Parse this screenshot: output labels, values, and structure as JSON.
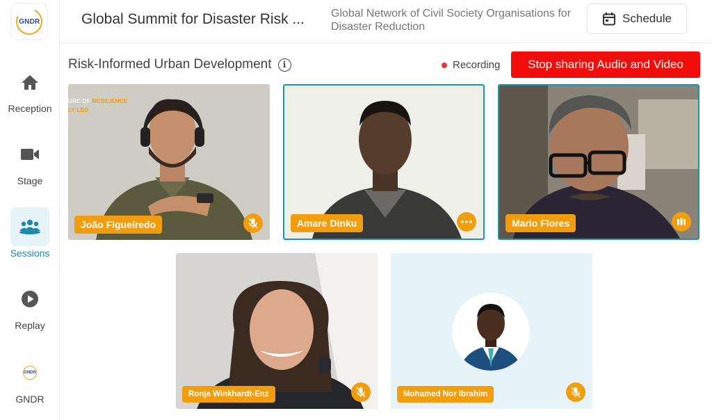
{
  "sidebar": {
    "logo_text": "GNDR",
    "items": [
      {
        "label": "Reception",
        "icon": "home-icon"
      },
      {
        "label": "Stage",
        "icon": "video-camera-icon"
      },
      {
        "label": "Sessions",
        "icon": "people-group-icon",
        "active": true
      },
      {
        "label": "Replay",
        "icon": "play-icon"
      },
      {
        "label": "GNDR",
        "icon": "gndr-logo-icon"
      }
    ]
  },
  "header": {
    "event_title": "Global Summit for Disaster Risk ...",
    "organization": "Global Network of Civil Society Organisations for Disaster Reduction",
    "schedule_label": "Schedule"
  },
  "session": {
    "title": "Risk-Informed Urban Development",
    "info_icon": "i",
    "recording_label": "Recording",
    "stop_label": "Stop sharing Audio and Video"
  },
  "participants": [
    {
      "name": "João Figueiredo",
      "status": "muted",
      "backdrop_text_1": "URE OF RESILIENCE",
      "backdrop_text_2": "LY LED"
    },
    {
      "name": "Amare Dinku",
      "status": "more",
      "speaking": true
    },
    {
      "name": "Mario Flores",
      "status": "talking",
      "speaking": true
    },
    {
      "name": "Ronja Winkhardt-Enz",
      "status": "muted"
    },
    {
      "name": "Mohamed Nor Ibrahim",
      "status": "muted",
      "avatar_only": true
    }
  ],
  "colors": {
    "accent": "#1a8aa8",
    "tag": "#f29d0e",
    "stop": "#f20d0d",
    "recording_dot": "#e53935"
  }
}
